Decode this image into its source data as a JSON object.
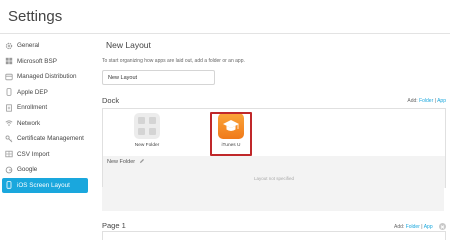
{
  "app": {
    "title": "Settings"
  },
  "sidebar": {
    "items": [
      {
        "label": "General",
        "icon": "gear-icon"
      },
      {
        "label": "Microsoft BSP",
        "icon": "windows-icon"
      },
      {
        "label": "Managed Distribution",
        "icon": "grid-icon"
      },
      {
        "label": "Apple DEP",
        "icon": "device-icon"
      },
      {
        "label": "Enrollment",
        "icon": "document-icon"
      },
      {
        "label": "Network",
        "icon": "wifi-icon"
      },
      {
        "label": "Certificate Management",
        "icon": "key-icon"
      },
      {
        "label": "CSV Import",
        "icon": "table-icon"
      },
      {
        "label": "Google",
        "icon": "google-icon"
      },
      {
        "label": "iOS Screen Layout",
        "icon": "phone-icon",
        "active": true
      }
    ]
  },
  "main": {
    "title": "New Layout",
    "hint": "To start organizing how apps are laid out, add a folder or an app.",
    "layout_name_value": "New Layout",
    "dock": {
      "label": "Dock",
      "add_prefix": "Add:",
      "add_folder": "Folder",
      "separator": "|",
      "add_app": "App",
      "apps": [
        {
          "label": "New Folder",
          "icon": "folder-icon"
        },
        {
          "label": "iTunes U",
          "icon": "itunes-u-icon",
          "highlighted": true
        }
      ]
    },
    "folder_panel": {
      "name": "New Folder",
      "empty_text": "Layout not specified"
    },
    "page": {
      "label": "Page 1",
      "add_prefix": "Add:",
      "add_folder": "Folder",
      "separator": "|",
      "add_app": "App"
    }
  },
  "colors": {
    "accent": "#1aa7dd",
    "highlight": "#c0282a",
    "itunes": "#f58a22"
  }
}
